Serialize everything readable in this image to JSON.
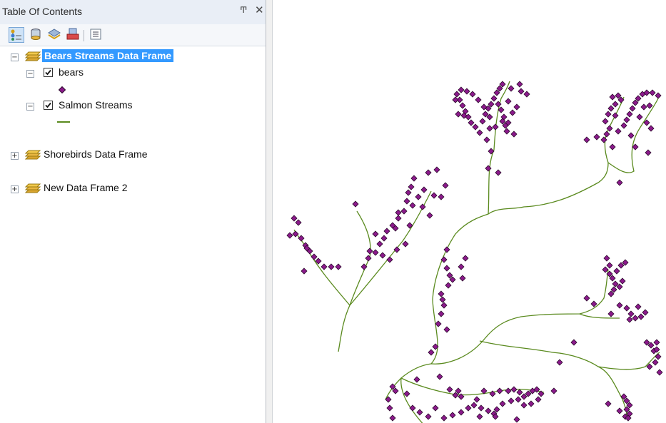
{
  "toc": {
    "title": "Table Of Contents",
    "pin_glyph": "Ͳ",
    "close_glyph": "✕",
    "toolbar": [
      {
        "name": "list-by-drawing-order-icon"
      },
      {
        "name": "list-by-source-icon"
      },
      {
        "name": "list-by-visibility-icon"
      },
      {
        "name": "list-by-selection-icon"
      },
      {
        "name": "options-icon"
      }
    ],
    "data_frames": [
      {
        "label": "Bears Streams Data Frame",
        "expanded": true,
        "active": true,
        "layers": [
          {
            "label": "bears",
            "checked": true,
            "symbol": "point-symbol",
            "symbol_color": "#8b1a8b"
          },
          {
            "label": "Salmon Streams",
            "checked": true,
            "symbol": "line-symbol",
            "symbol_color": "#5a8a1e"
          }
        ]
      },
      {
        "label": "Shorebirds Data Frame",
        "expanded": false,
        "active": false
      },
      {
        "label": "New Data Frame 2",
        "expanded": false,
        "active": false
      }
    ],
    "expander_expanded": "−",
    "expander_collapsed": "+"
  },
  "map": {
    "background": "#ffffff",
    "stream_color": "#5a8a1e",
    "point_fill": "#8b1a8b",
    "point_stroke": "#2a0a2a"
  }
}
